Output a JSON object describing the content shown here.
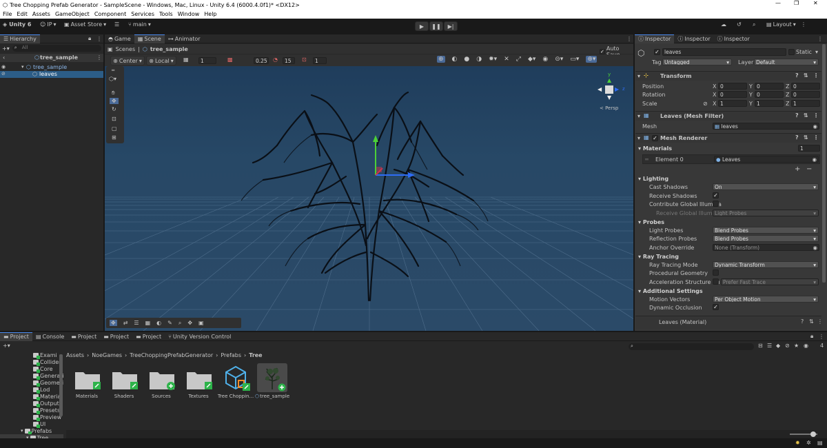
{
  "window": {
    "title": "Tree Chopping Prefab Generator - SampleScene - Windows, Mac, Linux - Unity 6.4 (6000.4.0f1)* <DX12>"
  },
  "menu": [
    "File",
    "Edit",
    "Assets",
    "GameObject",
    "Component",
    "Services",
    "Tools",
    "Window",
    "Help"
  ],
  "toolbar": {
    "account": "Unity 6",
    "ip": "IP",
    "asset_store": "Asset Store",
    "branch": "main",
    "layout": "Layout"
  },
  "hierarchy": {
    "tab": "Hierarchy",
    "search_placeholder": "All",
    "scene": "tree_sample",
    "items": [
      "tree_sample",
      "leaves"
    ]
  },
  "scene_view": {
    "tabs": [
      "Game",
      "Scene",
      "Animator"
    ],
    "breadcrumb": [
      "Scenes",
      "tree_sample"
    ],
    "auto_save": "Auto Save",
    "pivot": "Center",
    "space": "Local",
    "grid_value": "1",
    "snap_value": "0.25",
    "angle_value": "15",
    "scale_value": "1",
    "persp": "< Persp",
    "gizmo_axes": {
      "y": "y",
      "z": "z"
    }
  },
  "inspector": {
    "tabs": [
      "Inspector",
      "Inspector",
      "Inspector"
    ],
    "object_name": "leaves",
    "static_label": "Static",
    "tag_label": "Tag",
    "tag": "Untagged",
    "layer_label": "Layer",
    "layer": "Default",
    "transform": {
      "title": "Transform",
      "rows": [
        {
          "label": "Position",
          "x": "0",
          "y": "0",
          "z": "0"
        },
        {
          "label": "Rotation",
          "x": "0",
          "y": "0",
          "z": "0"
        },
        {
          "label": "Scale",
          "x": "1",
          "y": "1",
          "z": "1"
        }
      ]
    },
    "mesh_filter": {
      "title": "Leaves (Mesh Filter)",
      "mesh_label": "Mesh",
      "mesh": "leaves"
    },
    "mesh_renderer": {
      "title": "Mesh Renderer",
      "materials_label": "Materials",
      "materials_count": "1",
      "element_label": "Element 0",
      "element_value": "Leaves",
      "lighting": "Lighting",
      "cast_shadows_label": "Cast Shadows",
      "cast_shadows": "On",
      "receive_shadows_label": "Receive Shadows",
      "contribute_gi_label": "Contribute Global Illumina",
      "receive_gi_label": "Receive Global Illumina",
      "receive_gi": "Light Probes",
      "probes": "Probes",
      "light_probes_label": "Light Probes",
      "light_probes": "Blend Probes",
      "reflection_probes_label": "Reflection Probes",
      "reflection_probes": "Blend Probes",
      "anchor_label": "Anchor Override",
      "anchor": "None (Transform)",
      "ray_tracing": "Ray Tracing",
      "rt_mode_label": "Ray Tracing Mode",
      "rt_mode": "Dynamic Transform",
      "procedural_label": "Procedural Geometry",
      "accel_label": "Acceleration Structure Bu",
      "accel": "Prefer Fast Trace",
      "additional": "Additional Settings",
      "motion_label": "Motion Vectors",
      "motion": "Per Object Motion",
      "dyn_occ_label": "Dynamic Occlusion"
    },
    "material_footer": "Leaves (Material)"
  },
  "bottom": {
    "tabs": [
      "Project",
      "Console",
      "Project",
      "Project",
      "Project",
      "Unity Version Control"
    ],
    "breadcrumb": [
      "Assets",
      "NoeGames",
      "TreeChoppingPrefabGenerator",
      "Prefabs",
      "Tree"
    ],
    "tree_items": [
      "Exami",
      "Collideri",
      "Core",
      "Generati",
      "Geometi",
      "Lod",
      "Material",
      "Output",
      "Presets",
      "Preview",
      "UI",
      "Prefabs",
      "Tree"
    ],
    "assets": [
      "Materials",
      "Shaders",
      "Sources",
      "Textures",
      "Tree Choppin...",
      "tree_sample"
    ],
    "hidden_count": "4"
  }
}
